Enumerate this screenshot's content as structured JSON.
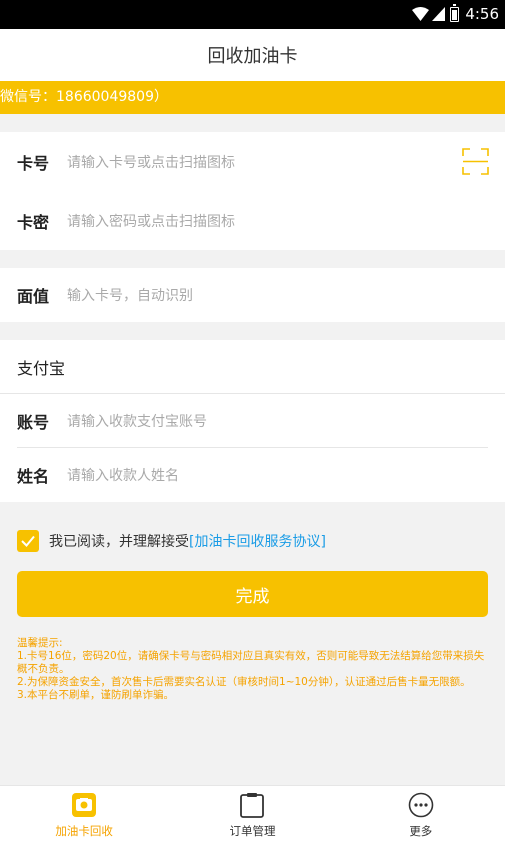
{
  "status_bar": {
    "time": "4:56"
  },
  "header": {
    "title": "回收加油卡"
  },
  "notice": {
    "text": "微信号：18660049809）"
  },
  "card_section": {
    "card_no": {
      "label": "卡号",
      "placeholder": "请输入卡号或点击扫描图标"
    },
    "card_pwd": {
      "label": "卡密",
      "placeholder": "请输入密码或点击扫描图标"
    }
  },
  "face_value": {
    "label": "面值",
    "placeholder": "输入卡号，自动识别"
  },
  "alipay": {
    "title": "支付宝",
    "account": {
      "label": "账号",
      "placeholder": "请输入收款支付宝账号"
    },
    "name": {
      "label": "姓名",
      "placeholder": "请输入收款人姓名"
    }
  },
  "agreement": {
    "text": "我已阅读，并理解接受",
    "link": "[加油卡回收服务协议]",
    "checked": true
  },
  "submit_label": "完成",
  "tips": [
    "温馨提示:",
    "1.卡号16位，密码20位，请确保卡号与密码相对应且真实有效，否则可能导致无法结算给您带来损失概不负责。",
    "2.为保障资金安全，首次售卡后需要实名认证（审核时间1~10分钟），认证通过后售卡量无限额。",
    "3.本平台不刷单，谨防刷单诈骗。"
  ],
  "tabbar": {
    "items": [
      {
        "label": "加油卡回收",
        "icon": "card-recycle-icon",
        "active": true
      },
      {
        "label": "订单管理",
        "icon": "clipboard-icon",
        "active": false
      },
      {
        "label": "更多",
        "icon": "more-icon",
        "active": false
      }
    ]
  },
  "colors": {
    "accent": "#f7c100",
    "tip": "#f5a300",
    "link": "#1a9ce6"
  }
}
